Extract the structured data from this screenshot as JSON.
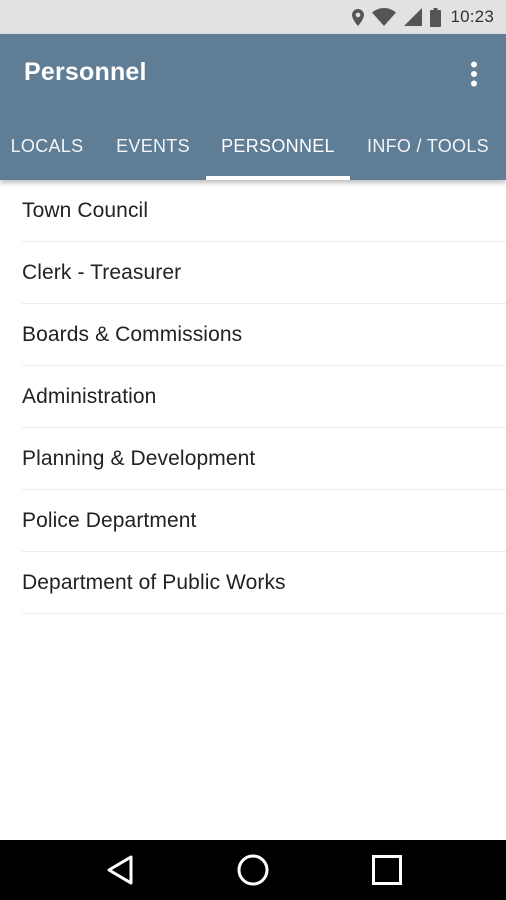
{
  "status_bar": {
    "time": "10:23",
    "icons": [
      "location-icon",
      "wifi-icon",
      "signal-icon",
      "battery-icon"
    ]
  },
  "app_bar": {
    "title": "Personnel",
    "background_color": "#607d96",
    "menu_icon": "more-vert-icon"
  },
  "tabs": [
    {
      "label": "LOCALS",
      "selected": false
    },
    {
      "label": "EVENTS",
      "selected": false
    },
    {
      "label": "PERSONNEL",
      "selected": true
    },
    {
      "label": "INFO / TOOLS",
      "selected": false
    }
  ],
  "list": {
    "items": [
      {
        "label": "Town Council"
      },
      {
        "label": "Clerk - Treasurer"
      },
      {
        "label": "Boards & Commissions"
      },
      {
        "label": "Administration"
      },
      {
        "label": "Planning & Development"
      },
      {
        "label": "Police Department"
      },
      {
        "label": "Department of Public Works"
      }
    ]
  },
  "nav_bar": {
    "icons": [
      "back-icon",
      "home-icon",
      "recents-icon"
    ]
  }
}
